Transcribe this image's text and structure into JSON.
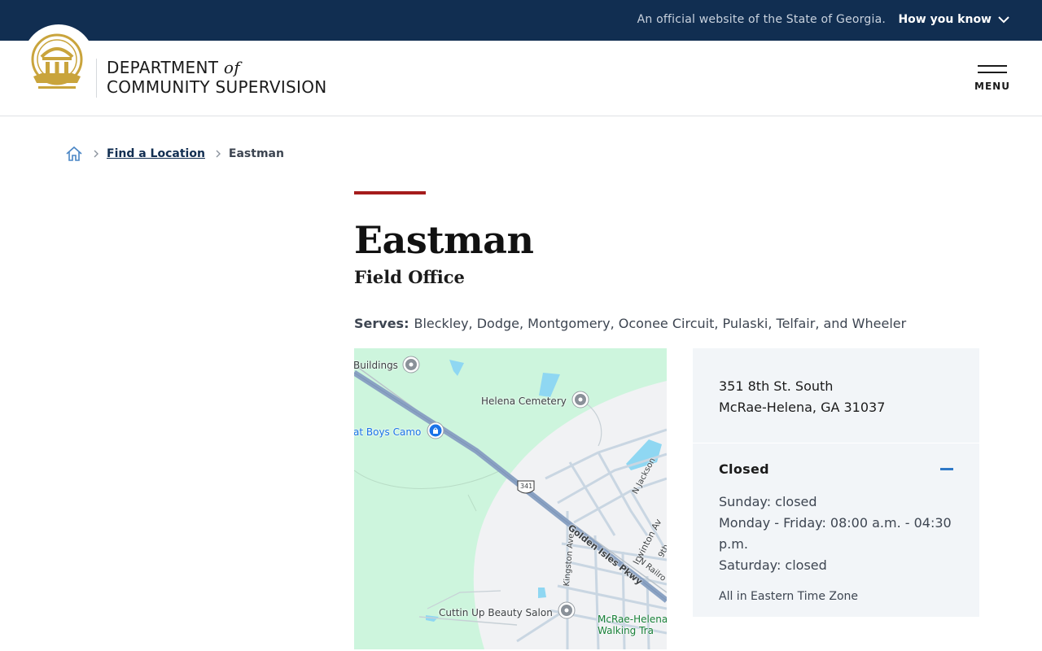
{
  "topbar": {
    "official_text": "An official website of the State of Georgia.",
    "how_you_know": "How you know"
  },
  "header": {
    "dept_line1": "DEPARTMENT",
    "dept_of": "of",
    "dept_line2": "COMMUNITY SUPERVISION",
    "menu_label": "MENU"
  },
  "breadcrumb": {
    "home_icon": "home-icon",
    "link": "Find a Location",
    "current": "Eastman"
  },
  "office": {
    "title": "Eastman",
    "subtitle": "Field Office",
    "serves_label": "Serves:",
    "serves_value": "Bleckley, Dodge, Montgomery, Oconee Circuit, Pulaski, Telfair, and Wheeler"
  },
  "map": {
    "labels": {
      "buildings": "Buildings",
      "helena_cemetery": "Helena Cemetery",
      "boys_camo": "at Boys Camo",
      "route": "341",
      "n_jackson": "N Jackson",
      "irwinton": "Irwinton Av",
      "ninth": "9th",
      "golden_isles": "Golden Isles Pkwy",
      "n_railroad": "N Railro",
      "kingston": "Kingston Ave",
      "cuttin_up": "Cuttin Up Beauty Salon",
      "trail_line1": "McRae-Helena",
      "trail_line2": "Walking Tra"
    }
  },
  "card": {
    "address_line1": "351 8th St. South",
    "address_line2": "McRae-Helena, GA 31037",
    "status": "Closed",
    "hours": [
      "Sunday: closed",
      "Monday - Friday: 08:00 a.m. - 04:30 p.m.",
      "Saturday: closed"
    ],
    "timezone": "All in Eastern Time Zone"
  },
  "colors": {
    "topbar": "#112e51",
    "accent": "#a51c1c",
    "seal": "#c9a43c",
    "card_bg": "#f2f5f8",
    "status_icon": "#2e78c7"
  }
}
